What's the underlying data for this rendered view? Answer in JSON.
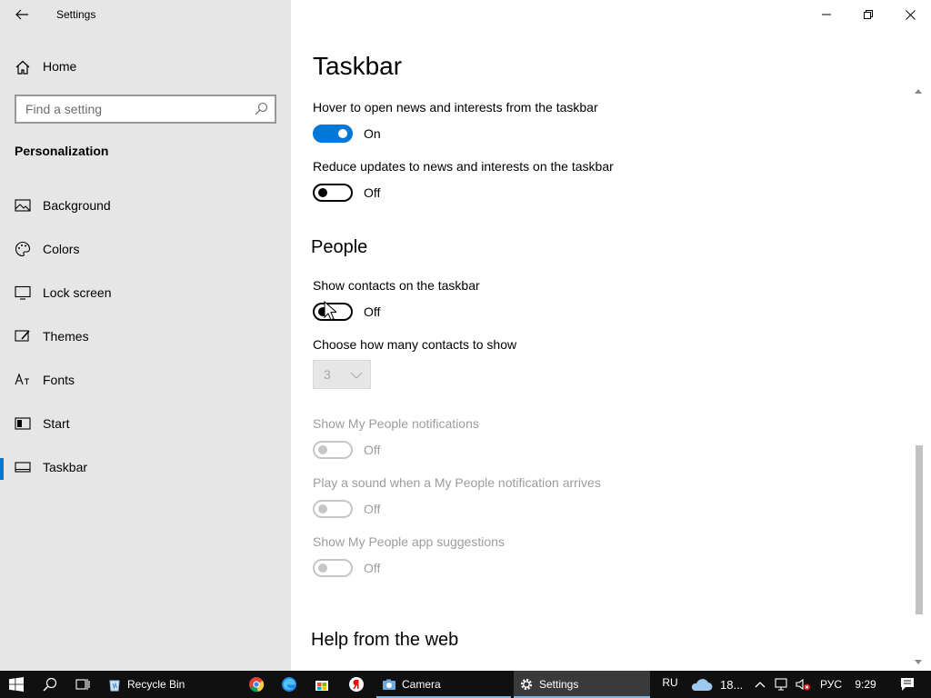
{
  "window": {
    "title": "Settings"
  },
  "sidebar": {
    "home_label": "Home",
    "search_placeholder": "Find a setting",
    "section": "Personalization",
    "items": [
      {
        "label": "Background",
        "icon": "image-icon"
      },
      {
        "label": "Colors",
        "icon": "palette-icon"
      },
      {
        "label": "Lock screen",
        "icon": "monitor-icon"
      },
      {
        "label": "Themes",
        "icon": "brush-icon"
      },
      {
        "label": "Fonts",
        "icon": "font-icon"
      },
      {
        "label": "Start",
        "icon": "start-icon"
      },
      {
        "label": "Taskbar",
        "icon": "taskbar-icon",
        "active": true
      }
    ]
  },
  "main": {
    "title": "Taskbar",
    "settings": [
      {
        "label": "Hover to open news and interests from the taskbar",
        "state": "On",
        "enabled": true,
        "on": true
      },
      {
        "label": "Reduce updates to news and interests on the taskbar",
        "state": "Off",
        "enabled": true,
        "on": false
      }
    ],
    "people": {
      "heading": "People",
      "show_contacts": {
        "label": "Show contacts on the taskbar",
        "state": "Off",
        "on": false
      },
      "contacts_count": {
        "label": "Choose how many contacts to show",
        "value": "3"
      },
      "notifications": {
        "label": "Show My People notifications",
        "state": "Off"
      },
      "sound": {
        "label": "Play a sound when a My People notification arrives",
        "state": "Off"
      },
      "suggestions": {
        "label": "Show My People app suggestions",
        "state": "Off"
      }
    },
    "help_heading": "Help from the web"
  },
  "taskbar": {
    "apps": [
      {
        "label": "Recycle Bin"
      },
      {
        "label": "Camera"
      },
      {
        "label": "Settings",
        "active": true
      }
    ],
    "tray": {
      "language": "RU",
      "weather": "18...",
      "input_lang": "РУС",
      "time": "9:29"
    }
  },
  "colors": {
    "accent": "#0078d7",
    "sidebar_bg": "#e6e6e6",
    "taskbar_bg": "#101010"
  }
}
